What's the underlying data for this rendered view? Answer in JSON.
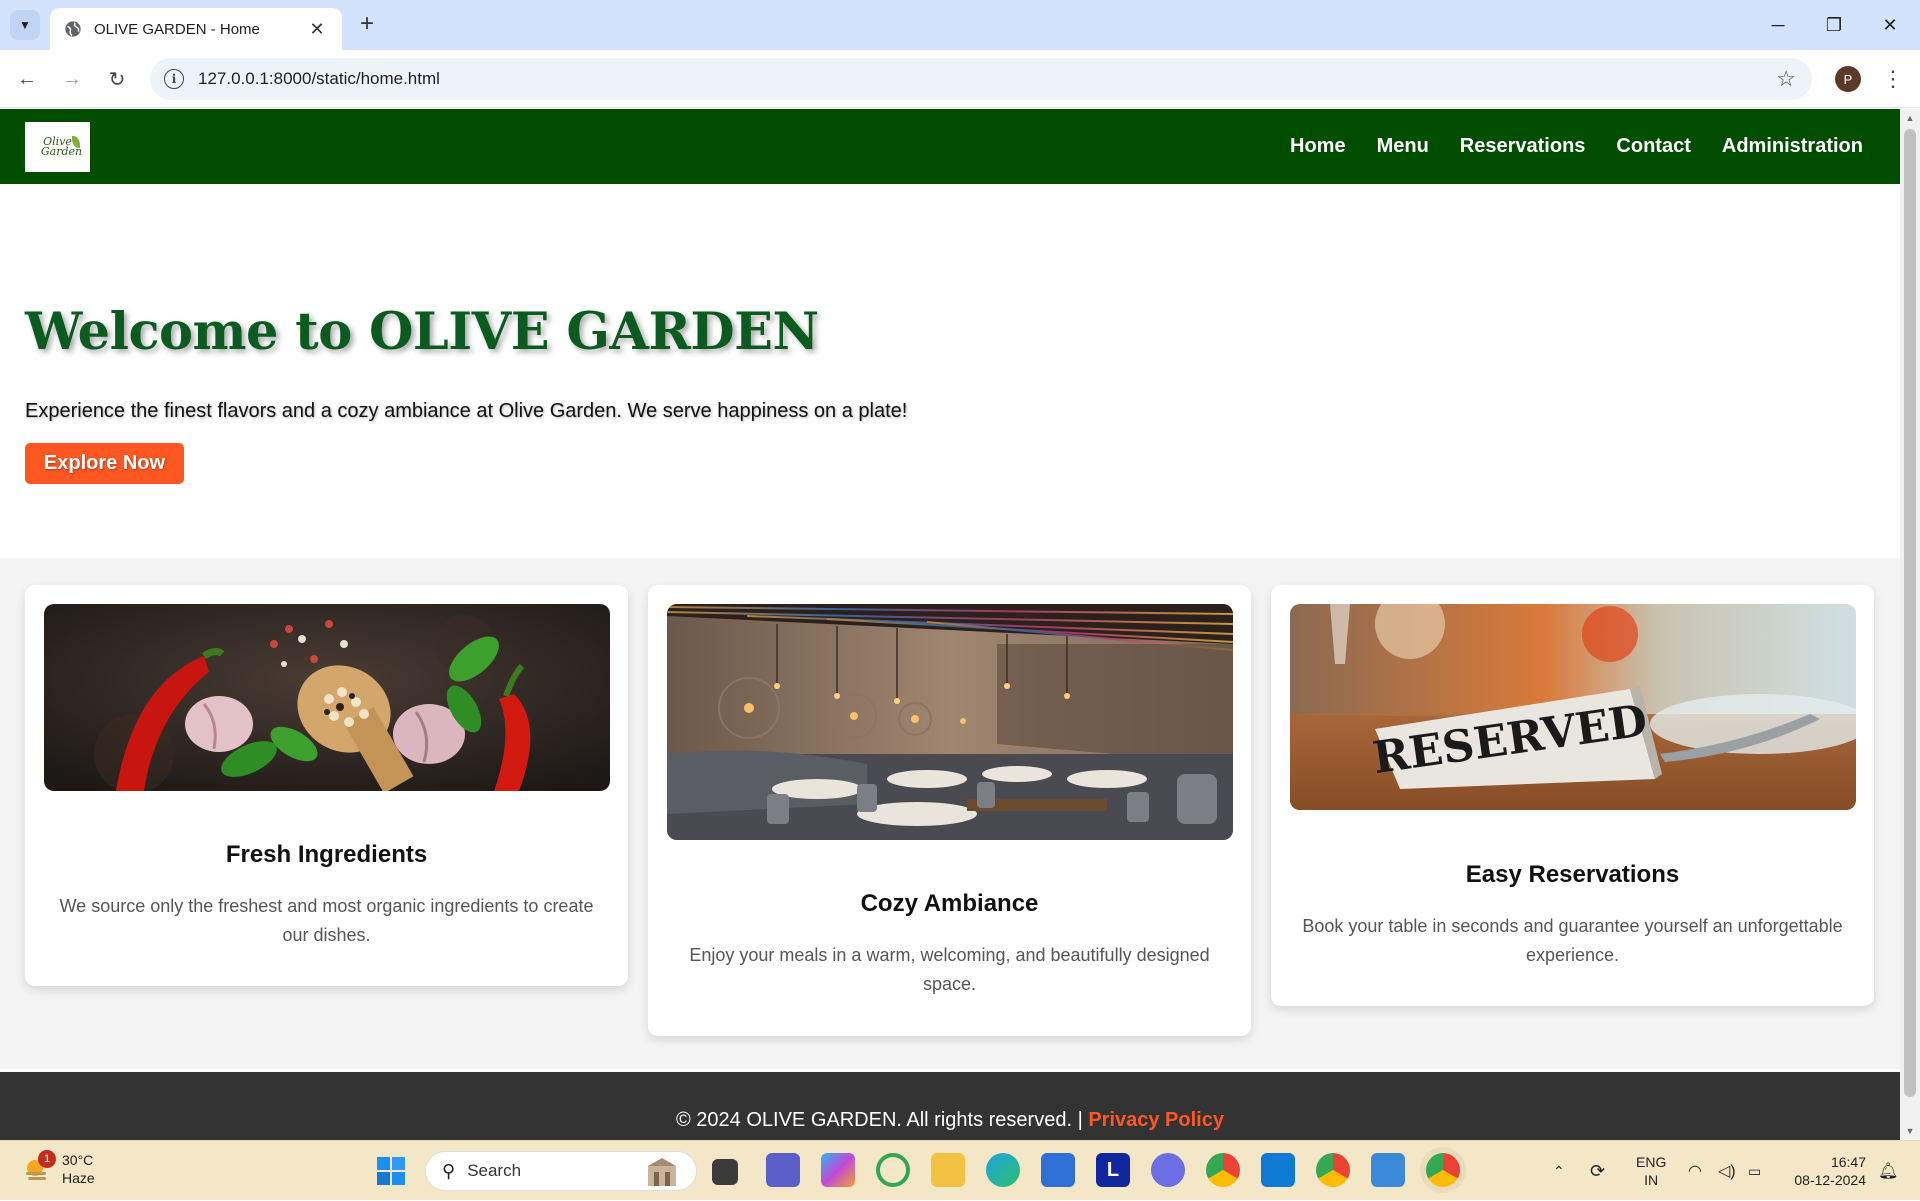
{
  "browser": {
    "tab_title": "OLIVE GARDEN - Home",
    "url": "127.0.0.1:8000/static/home.html",
    "profile_initial": "P"
  },
  "site": {
    "logo_line1": "Olive",
    "logo_line2": "Garden",
    "nav": [
      "Home",
      "Menu",
      "Reservations",
      "Contact",
      "Administration"
    ],
    "header_color": "#004d00"
  },
  "hero": {
    "title": "Welcome to OLIVE GARDEN",
    "subtitle": "Experience the finest flavors and a cozy ambiance at Olive Garden. We serve happiness on a plate!",
    "button": "Explore Now",
    "accent_color": "#ff5722"
  },
  "features": [
    {
      "title": "Fresh Ingredients",
      "text": "We source only the freshest and most organic ingredients to create our dishes.",
      "image": "spices-photo"
    },
    {
      "title": "Cozy Ambiance",
      "text": "Enjoy your meals in a warm, welcoming, and beautifully designed space.",
      "image": "restaurant-interior-photo"
    },
    {
      "title": "Easy Reservations",
      "text": "Book your table in seconds and guarantee yourself an unforgettable experience.",
      "image": "reserved-sign-photo",
      "sign_text": "RESERVED"
    }
  ],
  "footer": {
    "text": "© 2024 OLIVE GARDEN. All rights reserved. |",
    "link": "Privacy Policy"
  },
  "taskbar": {
    "weather_temp": "30°C",
    "weather_desc": "Haze",
    "weather_badge": "1",
    "search_label": "Search",
    "lang_line1": "ENG",
    "lang_line2": "IN",
    "time": "16:47",
    "date": "08-12-2024"
  }
}
